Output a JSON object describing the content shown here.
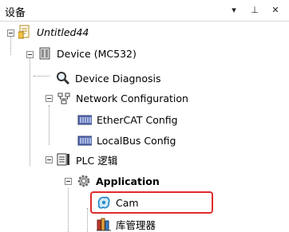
{
  "panel": {
    "title": "设备",
    "buttons": {
      "dropdown": "▾",
      "pin": "⊥",
      "close": "✕"
    }
  },
  "tree": {
    "root": "Untitled44",
    "device": "Device (MC532)",
    "device_diagnosis": "Device Diagnosis",
    "network_configuration": "Network Configuration",
    "ethercat_config": "EtherCAT Config",
    "localbus_config": "LocalBus Config",
    "plc_logic": "PLC 逻辑",
    "application": "Application",
    "cam": "Cam",
    "library_manager": "库管理器"
  },
  "colors": {
    "highlight": "#e02b2b"
  }
}
